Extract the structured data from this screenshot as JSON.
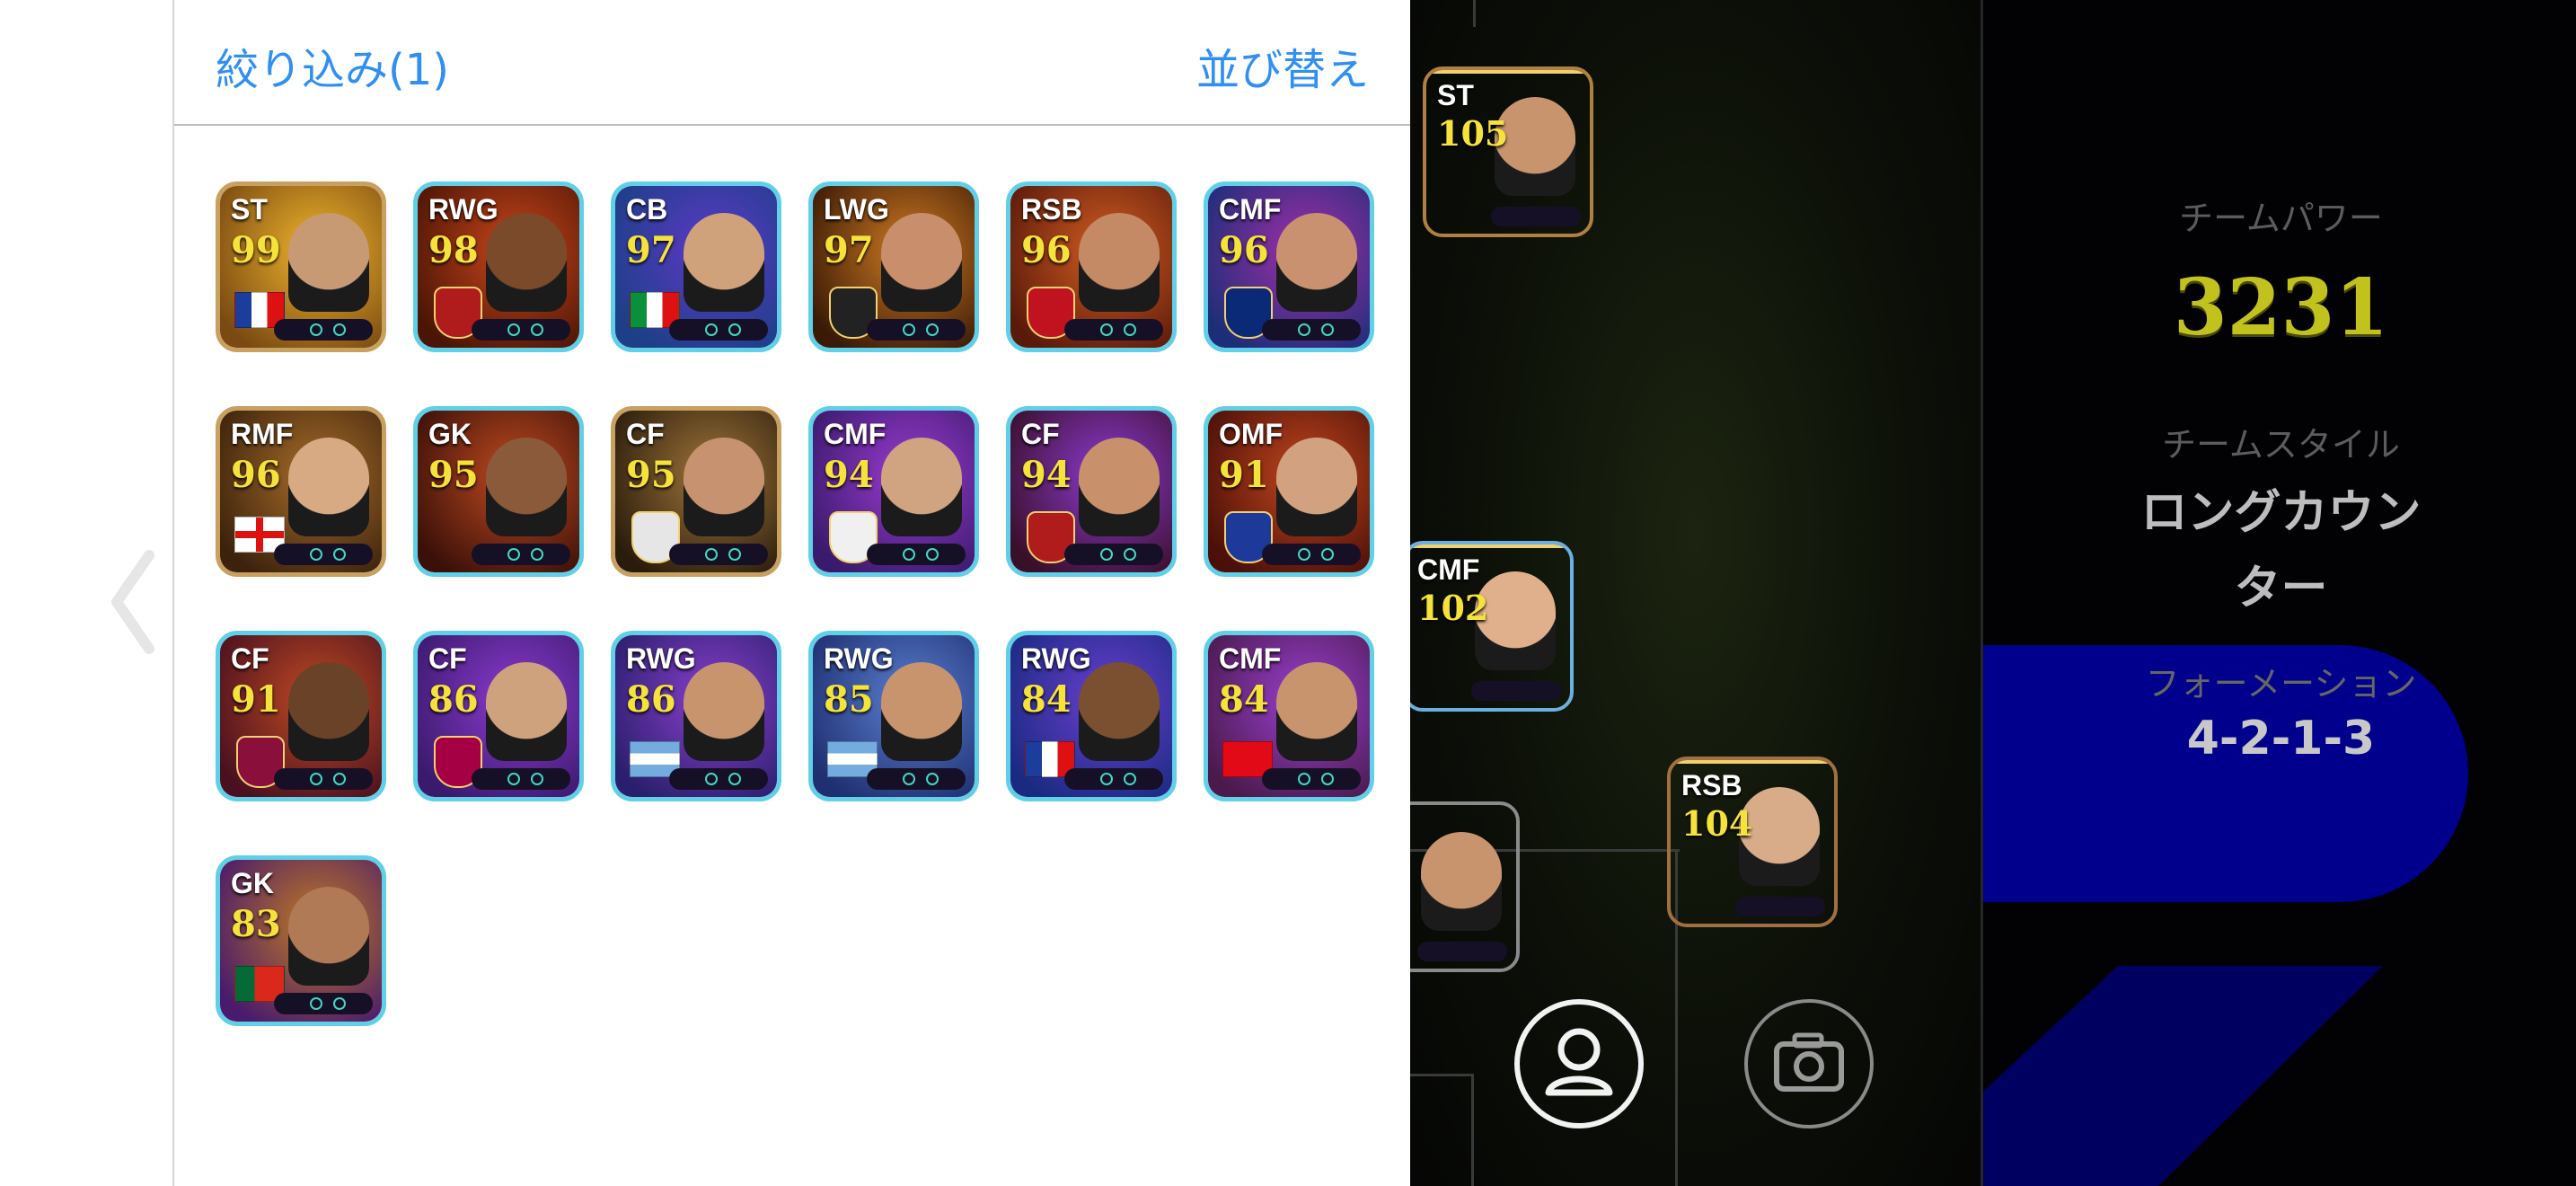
{
  "header": {
    "filter_label": "絞り込み(1)",
    "sort_label": "並び替え"
  },
  "players": [
    {
      "pos": "ST",
      "rating": "99",
      "bg": [
        "#f0b52c",
        "#7a4a12"
      ],
      "head": "#c79a74",
      "flag": "fr"
    },
    {
      "pos": "RWG",
      "rating": "98",
      "bg": [
        "#c9451b",
        "#4a1505"
      ],
      "head": "#7a4a2a",
      "crest": "#b01b1b"
    },
    {
      "pos": "CB",
      "rating": "97",
      "bg": [
        "#5d39c7",
        "#1c3f86"
      ],
      "head": "#d0a27c",
      "flag": "it"
    },
    {
      "pos": "LWG",
      "rating": "97",
      "bg": [
        "#d07a22",
        "#3a1a06"
      ],
      "head": "#c98f6c",
      "crest": "#222"
    },
    {
      "pos": "RSB",
      "rating": "96",
      "bg": [
        "#d25c22",
        "#5a1a0a"
      ],
      "head": "#c48a66",
      "crest": "#c1121f"
    },
    {
      "pos": "CMF",
      "rating": "96",
      "bg": [
        "#a32ea8",
        "#1d2e78"
      ],
      "head": "#c99170",
      "crest": "#0a2a78"
    },
    {
      "pos": "RMF",
      "rating": "96",
      "bg": [
        "#a86d2a",
        "#3c220c"
      ],
      "head": "#d7aa84",
      "flag": "en"
    },
    {
      "pos": "GK",
      "rating": "95",
      "bg": [
        "#c04a20",
        "#3a1008"
      ],
      "head": "#8a5a3a"
    },
    {
      "pos": "CF",
      "rating": "95",
      "bg": [
        "#a0753a",
        "#2a1c0c"
      ],
      "head": "#c69270",
      "crest": "#e6e6e6"
    },
    {
      "pos": "CMF",
      "rating": "94",
      "bg": [
        "#9b3bd0",
        "#3a1a6c"
      ],
      "head": "#d0a480",
      "crest": "#f0f0f0"
    },
    {
      "pos": "CF",
      "rating": "94",
      "bg": [
        "#8c3ad0",
        "#3a0f2a"
      ],
      "head": "#c8916c",
      "crest": "#b01b1b"
    },
    {
      "pos": "OMF",
      "rating": "91",
      "bg": [
        "#c2461e",
        "#4a0f08"
      ],
      "head": "#d2a280",
      "crest": "#1d3a9a"
    },
    {
      "pos": "CF",
      "rating": "91",
      "bg": [
        "#c04a22",
        "#4a1020"
      ],
      "head": "#6a4228",
      "crest": "#8a0f3a"
    },
    {
      "pos": "CF",
      "rating": "86",
      "bg": [
        "#8c3ad0",
        "#3a1a6c"
      ],
      "head": "#cfa27e",
      "crest": "#a50044"
    },
    {
      "pos": "RWG",
      "rating": "86",
      "bg": [
        "#8a3fcc",
        "#2a1f6c"
      ],
      "head": "#c8946e",
      "flag": "ar"
    },
    {
      "pos": "RWG",
      "rating": "85",
      "bg": [
        "#5a7fd0",
        "#1f2f70"
      ],
      "head": "#c8946e",
      "flag": "ar"
    },
    {
      "pos": "RWG",
      "rating": "84",
      "bg": [
        "#6a3fd0",
        "#1a2a80"
      ],
      "head": "#7a5030",
      "flag": "fr"
    },
    {
      "pos": "CMF",
      "rating": "84",
      "bg": [
        "#9a3fd0",
        "#4a1a4c"
      ],
      "head": "#c8946e",
      "flag": "tr"
    },
    {
      "pos": "GK",
      "rating": "83",
      "bg": [
        "#c07a22",
        "#4a1a6c"
      ],
      "head": "#b07a56",
      "flag": "pt"
    }
  ],
  "pitch_players": [
    {
      "pos": "ST",
      "rating": "105",
      "bg": [
        "#c56a22",
        "#3a1a08"
      ],
      "head": "#c8946e",
      "crest": "#a50044"
    },
    {
      "pos": "CMF",
      "rating": "102",
      "bg": [
        "#6a4ad0",
        "#1d3f86"
      ],
      "head": "#e0b08c",
      "crest": "#4a7ab0"
    },
    {
      "pos": "RSB",
      "rating": "104",
      "bg": [
        "#4a6a2a",
        "#1a2a10"
      ],
      "head": "#d8ac88",
      "crest": "#c1121f"
    },
    {
      "pos": "",
      "rating": "",
      "bg": [
        "#2a8a3a",
        "#0f3a18"
      ],
      "head": "#c8946e"
    }
  ],
  "team": {
    "power_label": "チームパワー",
    "power_value": "3231",
    "style_label": "チームスタイル",
    "style_value_line1": "ロングカウン",
    "style_value_line2": "ター",
    "formation_label": "フォーメーション",
    "formation_value": "4-2-1-3"
  },
  "icons": {
    "back": "chevron-left-icon",
    "profile": "person-icon",
    "camera": "camera-icon"
  }
}
